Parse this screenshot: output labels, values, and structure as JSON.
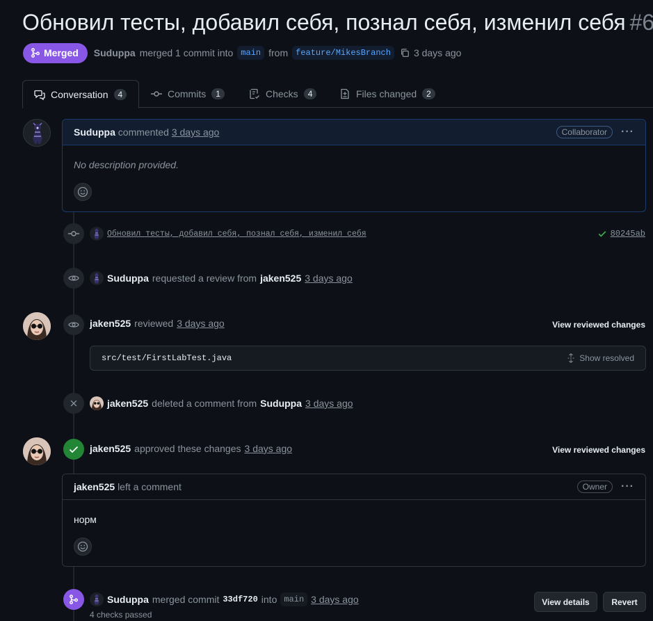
{
  "pr": {
    "title": "Обновил тесты, добавил себя, познал себя, изменил себя",
    "number": "#6",
    "status": "Merged",
    "author": "Suduppa",
    "merged_text": "merged 1 commit into",
    "base_branch": "main",
    "from_text": "from",
    "head_branch": "feature/MikesBranch",
    "time": "3 days ago"
  },
  "tabs": [
    {
      "label": "Conversation",
      "count": "4"
    },
    {
      "label": "Commits",
      "count": "1"
    },
    {
      "label": "Checks",
      "count": "4"
    },
    {
      "label": "Files changed",
      "count": "2"
    }
  ],
  "first_comment": {
    "author": "Suduppa",
    "action": "commented",
    "time": "3 days ago",
    "role": "Collaborator",
    "body": "No description provided."
  },
  "commit_event": {
    "message": "Обновил тесты, добавил себя, познал себя, изменил себя",
    "sha": "80245ab"
  },
  "review_request": {
    "actor": "Suduppa",
    "text": "requested a review from",
    "reviewer": "jaken525",
    "time": "3 days ago"
  },
  "review1": {
    "actor": "jaken525",
    "text": "reviewed",
    "time": "3 days ago",
    "link": "View reviewed changes",
    "file": "src/test/FirstLabTest.java",
    "show_resolved": "Show resolved"
  },
  "deleted": {
    "actor": "jaken525",
    "text": "deleted a comment from",
    "target": "Suduppa",
    "time": "3 days ago"
  },
  "approved": {
    "actor": "jaken525",
    "text": "approved these changes",
    "time": "3 days ago",
    "link": "View reviewed changes"
  },
  "second_comment": {
    "author": "jaken525",
    "action": "left a comment",
    "role": "Owner",
    "body": "норм"
  },
  "merge_event": {
    "actor": "Suduppa",
    "text": "merged commit",
    "sha": "33df720",
    "into": "into",
    "branch": "main",
    "time": "3 days ago",
    "checks": "4 checks passed",
    "view_details": "View details",
    "revert": "Revert"
  },
  "colors": {
    "merged": "#8957e5",
    "approved": "#238636",
    "link": "#58a6ff"
  }
}
